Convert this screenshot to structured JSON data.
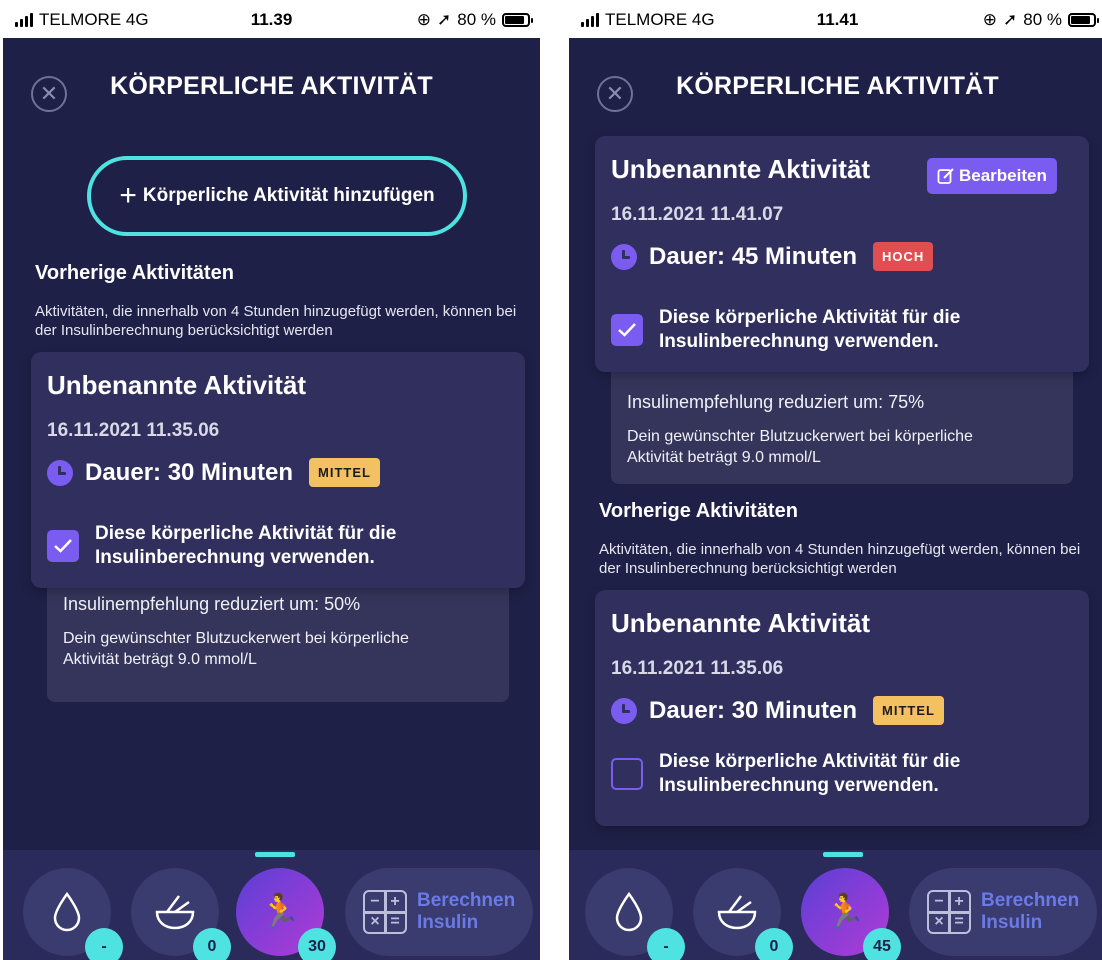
{
  "status_left": {
    "carrier": "TELMORE",
    "network": "4G",
    "time": "11.39",
    "battery": "80 %"
  },
  "status_right": {
    "carrier": "TELMORE",
    "network": "4G",
    "time": "11.41",
    "battery": "80 %"
  },
  "header": {
    "title": "KÖRPERLICHE AKTIVITÄT",
    "close_icon": "close-icon"
  },
  "left": {
    "add_button_label": "Körperliche Aktivität hinzufügen",
    "previous_title": "Vorherige Aktivitäten",
    "previous_desc": "Aktivitäten, die innerhalb von 4 Stunden hinzugefügt werden, können bei der Insulinberechnung berücksichtigt werden",
    "card": {
      "name": "Unbenannte Aktivität",
      "date": "16.11.2021 11.35.06",
      "duration": "Dauer: 30 Minuten",
      "intensity": "MITTEL",
      "checkbox_label": "Diese körperliche Aktivität für die Insulinberechnung verwenden.",
      "checked": true
    },
    "info": {
      "reduction": "Insulinempfehlung reduziert um: 50%",
      "target": "Dein gewünschter Blutzuckerwert bei körperliche Aktivität beträgt 9.0 mmol/L"
    },
    "tabbar": {
      "drop_count": "-",
      "food_count": "0",
      "activity_count": "30",
      "calc_label_1": "Berechnen",
      "calc_label_2": "Insulin"
    }
  },
  "right": {
    "current_card": {
      "name": "Unbenannte Aktivität",
      "edit_label": "Bearbeiten",
      "date": "16.11.2021 11.41.07",
      "duration": "Dauer: 45 Minuten",
      "intensity": "HOCH",
      "checkbox_label": "Diese körperliche Aktivität für die Insulinberechnung verwenden.",
      "checked": true
    },
    "info": {
      "reduction": "Insulinempfehlung reduziert um: 75%",
      "target": "Dein gewünschter Blutzuckerwert bei körperliche Aktivität beträgt 9.0 mmol/L"
    },
    "previous_title": "Vorherige Aktivitäten",
    "previous_desc": "Aktivitäten, die innerhalb von 4 Stunden hinzugefügt werden, können bei der Insulinberechnung berücksichtigt werden",
    "previous_card": {
      "name": "Unbenannte Aktivität",
      "date": "16.11.2021 11.35.06",
      "duration": "Dauer: 30 Minuten",
      "intensity": "MITTEL",
      "checkbox_label": "Diese körperliche Aktivität für die Insulinberechnung verwenden.",
      "checked": false
    },
    "tabbar": {
      "drop_count": "-",
      "food_count": "0",
      "activity_count": "45",
      "calc_label_1": "Berechnen",
      "calc_label_2": "Insulin"
    }
  },
  "colors": {
    "background": "#1e2048",
    "card": "#302f5e",
    "accent": "#7b5cf0",
    "teal": "#4ee3e0",
    "mittel": "#f3c062",
    "hoch": "#e04e52"
  }
}
